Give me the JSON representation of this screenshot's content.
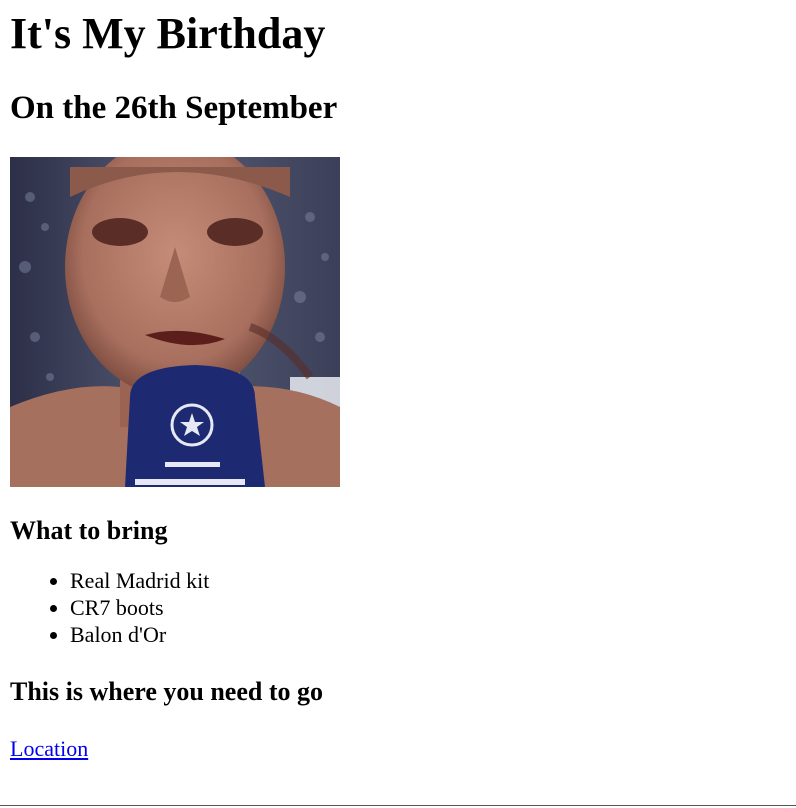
{
  "heading": {
    "title": "It's My Birthday",
    "date": "On the 26th September"
  },
  "photo": {
    "icon": "footballer-interview-image",
    "colors": {
      "skin": "#b07866",
      "mic": "#1d2a72",
      "crowd": "#4a4d63"
    }
  },
  "bring": {
    "title": "What to bring",
    "items": [
      "Real Madrid kit",
      "CR7 boots",
      "Balon d'Or"
    ]
  },
  "directions": {
    "title": "This is where you need to go",
    "link_label": "Location"
  },
  "colors": {
    "link": "#0000ee"
  }
}
